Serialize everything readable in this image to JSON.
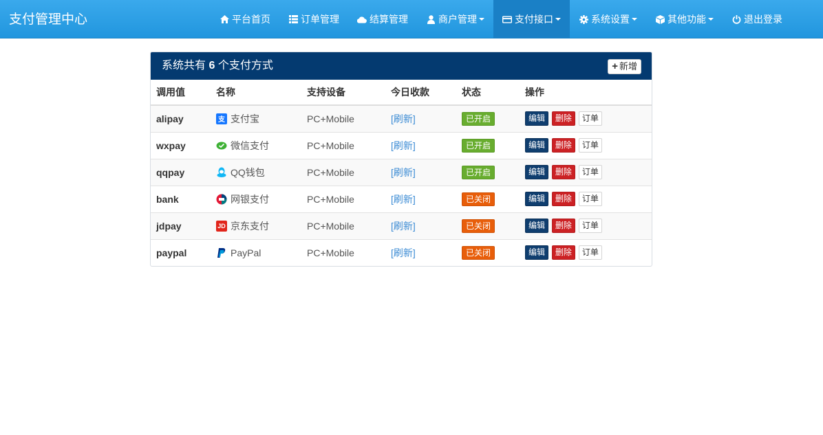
{
  "brand": "支付管理中心",
  "nav": [
    {
      "label": "平台首页",
      "icon": "home-icon"
    },
    {
      "label": "订单管理",
      "icon": "list-icon"
    },
    {
      "label": "结算管理",
      "icon": "cloud-icon"
    },
    {
      "label": "商户管理",
      "icon": "user-icon",
      "dropdown": true
    },
    {
      "label": "支付接口",
      "icon": "credit-card-icon",
      "dropdown": true,
      "active": true
    },
    {
      "label": "系统设置",
      "icon": "gear-icon",
      "dropdown": true
    },
    {
      "label": "其他功能",
      "icon": "cube-icon",
      "dropdown": true
    },
    {
      "label": "退出登录",
      "icon": "power-icon"
    }
  ],
  "panel": {
    "title_prefix": "系统共有",
    "count": "6",
    "title_suffix": "个支付方式",
    "add_label": "新增"
  },
  "table": {
    "headers": [
      "调用值",
      "名称",
      "支持设备",
      "今日收款",
      "状态",
      "操作"
    ],
    "rows": [
      {
        "code": "alipay",
        "name": "支付宝",
        "icon": "alipay-icon",
        "device": "PC+Mobile",
        "today": "[刷新]",
        "status": "已开启",
        "on": true
      },
      {
        "code": "wxpay",
        "name": "微信支付",
        "icon": "wechat-pay-icon",
        "device": "PC+Mobile",
        "today": "[刷新]",
        "status": "已开启",
        "on": true
      },
      {
        "code": "qqpay",
        "name": "QQ钱包",
        "icon": "qq-wallet-icon",
        "device": "PC+Mobile",
        "today": "[刷新]",
        "status": "已开启",
        "on": true
      },
      {
        "code": "bank",
        "name": "网银支付",
        "icon": "unionpay-icon",
        "device": "PC+Mobile",
        "today": "[刷新]",
        "status": "已关闭",
        "on": false
      },
      {
        "code": "jdpay",
        "name": "京东支付",
        "icon": "jd-icon",
        "device": "PC+Mobile",
        "today": "[刷新]",
        "status": "已关闭",
        "on": false
      },
      {
        "code": "paypal",
        "name": "PayPal",
        "icon": "paypal-icon",
        "device": "PC+Mobile",
        "today": "[刷新]",
        "status": "已关闭",
        "on": false
      }
    ],
    "actions": {
      "edit": "编辑",
      "delete": "删除",
      "order": "订单"
    }
  },
  "colors": {
    "navbar": "#2a9fe6",
    "panel_heading": "#043a70",
    "status_on": "#68ad2f",
    "status_off": "#e85e0a",
    "edit_button": "#0f3e6f",
    "delete_button": "#cc2124",
    "link": "#3b8bd4"
  }
}
